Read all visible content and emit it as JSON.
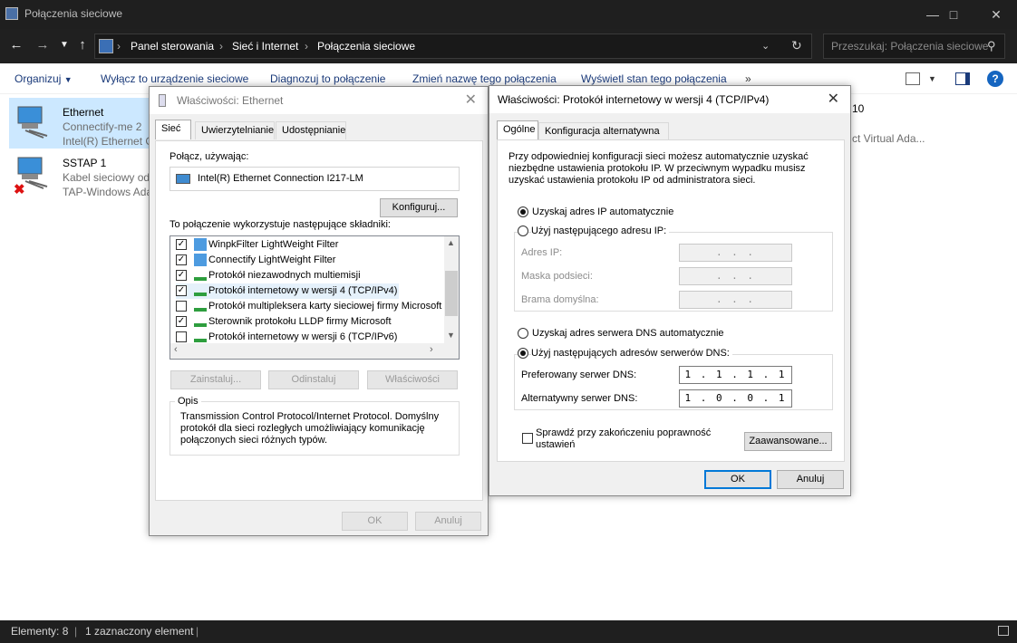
{
  "window": {
    "title": "Połączenia sieciowe"
  },
  "address": {
    "crumbs": [
      "Panel sterowania",
      "Sieć i Internet",
      "Połączenia sieciowe"
    ],
    "search_placeholder": "Przeszukaj: Połączenia sieciowe"
  },
  "commands": {
    "organize": "Organizuj",
    "disable": "Wyłącz to urządzenie sieciowe",
    "diagnose": "Diagnozuj to połączenie",
    "rename": "Zmień nazwę tego połączenia",
    "status": "Wyświetl stan tego połączenia",
    "more": "»"
  },
  "connections": [
    {
      "name": "Ethernet",
      "line2": "Connectify-me 2",
      "line3": "Intel(R) Ethernet C"
    },
    {
      "name": "SSTAP 1",
      "line2": "Kabel sieciowy odł",
      "line3": "TAP-Windows Ada"
    }
  ],
  "partial_texts": {
    "top": "10",
    "adapter": "ct Virtual Ada..."
  },
  "statusbar": {
    "count": "Elementy: 8",
    "selected": "1 zaznaczony element"
  },
  "eth_dialog": {
    "title": "Właściwości: Ethernet",
    "tabs": [
      "Sieć",
      "Uwierzytelnianie",
      "Udostępnianie"
    ],
    "connect_using_label": "Połącz, używając:",
    "adapter": "Intel(R) Ethernet Connection I217-LM",
    "configure": "Konfiguruj...",
    "components_label": "To połączenie wykorzystuje następujące składniki:",
    "components": [
      {
        "label": "WinpkFilter LightWeight Filter",
        "checked": true
      },
      {
        "label": "Connectify LightWeight Filter",
        "checked": true
      },
      {
        "label": "Protokół niezawodnych multiemisji",
        "checked": true
      },
      {
        "label": "Protokół internetowy w wersji 4 (TCP/IPv4)",
        "checked": true
      },
      {
        "label": "Protokół multipleksera karty sieciowej firmy Microsoft",
        "checked": false
      },
      {
        "label": "Sterownik protokołu LLDP firmy Microsoft",
        "checked": true
      },
      {
        "label": "Protokół internetowy w wersji 6 (TCP/IPv6)",
        "checked": false
      }
    ],
    "install": "Zainstaluj...",
    "uninstall": "Odinstaluj",
    "properties": "Właściwości",
    "desc_title": "Opis",
    "description": "Transmission Control Protocol/Internet Protocol. Domyślny protokół dla sieci rozległych umożliwiający komunikację połączonych sieci różnych typów.",
    "ok": "OK",
    "cancel": "Anuluj"
  },
  "ipv4_dialog": {
    "title": "Właściwości: Protokół internetowy w wersji 4 (TCP/IPv4)",
    "tabs": [
      "Ogólne",
      "Konfiguracja alternatywna"
    ],
    "intro": "Przy odpowiedniej konfiguracji sieci możesz automatycznie uzyskać niezbędne ustawienia protokołu IP. W przeciwnym wypadku musisz uzyskać ustawienia protokołu IP od administratora sieci.",
    "auto_ip": "Uzyskaj adres IP automatycznie",
    "manual_ip": "Użyj następującego adresu IP:",
    "ip_label": "Adres IP:",
    "mask_label": "Maska podsieci:",
    "gateway_label": "Brama domyślna:",
    "empty_ip": ".   .   .",
    "auto_dns": "Uzyskaj adres serwera DNS automatycznie",
    "manual_dns": "Użyj następujących adresów serwerów DNS:",
    "pref_dns_label": "Preferowany serwer DNS:",
    "pref_dns": "1 . 1 . 1 . 1",
    "alt_dns_label": "Alternatywny serwer DNS:",
    "alt_dns": "1 . 0 . 0 . 1",
    "validate": "Sprawdź przy zakończeniu poprawność ustawień",
    "advanced": "Zaawansowane...",
    "ok": "OK",
    "cancel": "Anuluj"
  }
}
